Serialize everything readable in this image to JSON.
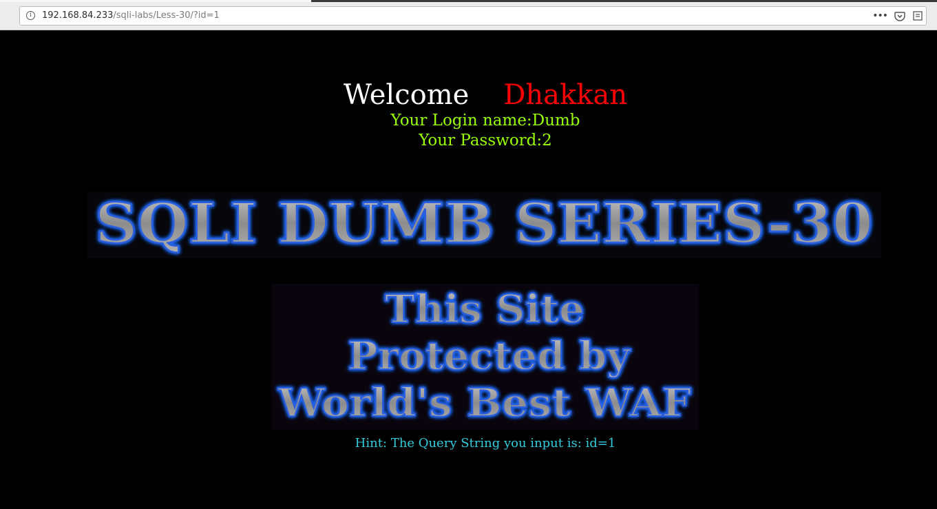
{
  "browser": {
    "url_host": "192.168.84.233",
    "url_path": "/sqli-labs/Less-30/?id=1",
    "info_icon": "info-icon",
    "more_icon": "more-icon",
    "pocket_icon": "pocket-icon",
    "reader_icon": "reader-view-icon"
  },
  "page": {
    "welcome_word": "Welcome",
    "welcome_name": "Dhakkan",
    "login_label": "Your Login name:",
    "login_value": "Dumb",
    "password_label": "Your Password:",
    "password_value": "2",
    "banner_title": "SQLI DUMB SERIES-30",
    "waf_banner_lines": [
      "This Site",
      "Protected by",
      "World's Best WAF"
    ],
    "hint": "Hint: The Query String you input is: id=1"
  },
  "colors": {
    "background": "#000000",
    "welcome": "#ffffff",
    "name": "#ff0000",
    "credentials": "#99ff00",
    "hint": "#33ccdd",
    "banner_glow": "#1e6cff",
    "banner_fill": "#9a9a9a"
  }
}
